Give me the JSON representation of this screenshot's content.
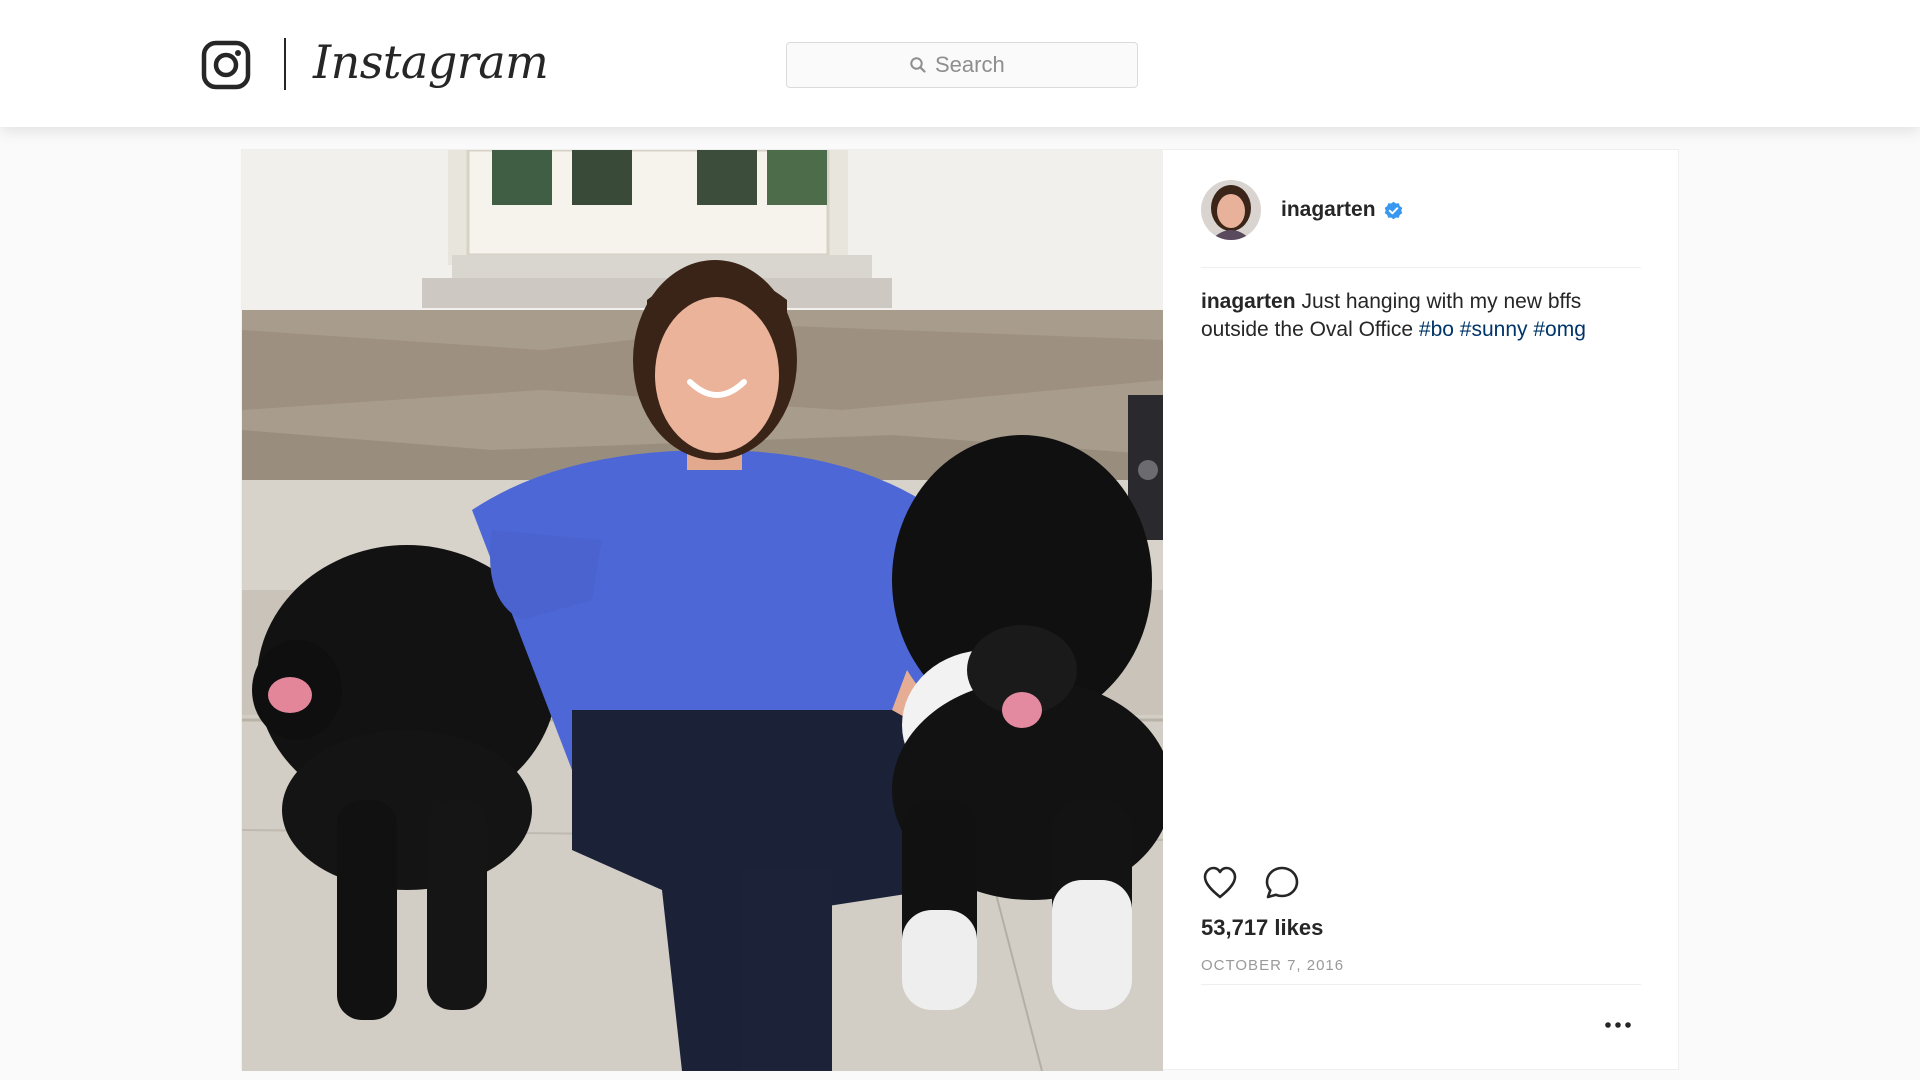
{
  "app": {
    "wordmark": "Instagram"
  },
  "search": {
    "placeholder": "Search"
  },
  "post": {
    "username": "inagarten",
    "verified": true,
    "caption": {
      "author": "inagarten",
      "text": "Just hanging with my new bffs outside the Oval Office",
      "hashtags": [
        "#bo",
        "#sunny",
        "#omg"
      ]
    },
    "likes": "53,717 likes",
    "date": "OCTOBER 7, 2016",
    "actions": {
      "like_icon": "heart-icon",
      "comment_icon": "comment-icon",
      "more_icon": "more-options-icon"
    }
  },
  "colors": {
    "hashtag": "#003569",
    "verified": "#3897f0",
    "text": "#262626",
    "muted": "#999999",
    "border": "#efefef"
  }
}
